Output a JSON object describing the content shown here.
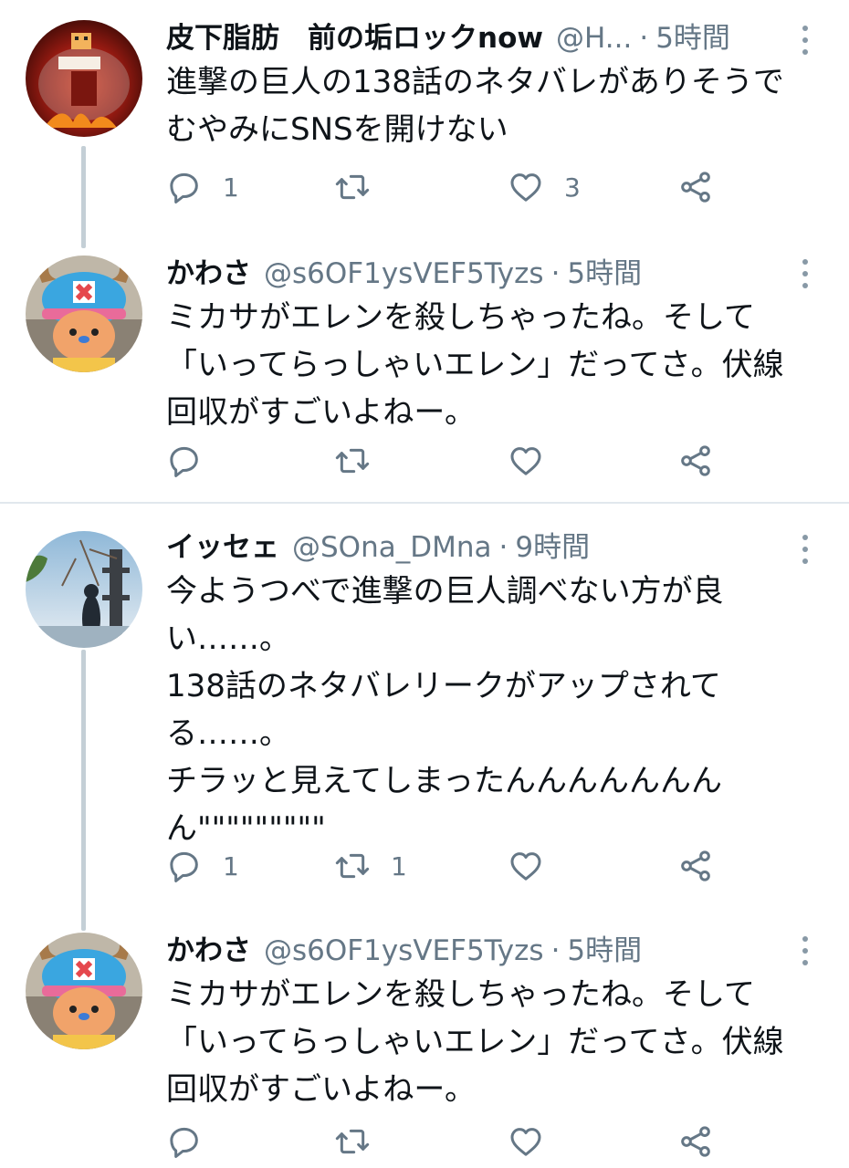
{
  "tweets": [
    {
      "name": "皮下脂肪　前の垢ロックnow",
      "handle": "@H...",
      "time": "5時間",
      "text": "進撃の巨人の138話のネタバレがありそうで\nむやみにSNSを開けない",
      "reply_count": "1",
      "retweet_count": "",
      "like_count": "3",
      "avatar_icon": "fire-character-avatar",
      "avatar_label": "皮下脂肪"
    },
    {
      "name": "かわさ",
      "handle": "@s6OF1ysVEF5Tyzs",
      "time": "5時間",
      "text": "ミカサがエレンを殺しちゃったね。そして\n「いってらっしゃいエレン」だってさ。伏線\n回収がすごいよねー。",
      "reply_count": "",
      "retweet_count": "",
      "like_count": "",
      "avatar_icon": "chopper-mascot-avatar"
    },
    {
      "name": "イッセェ",
      "handle": "@SOna_DMna",
      "time": "9時間",
      "text": "今ようつべで進撃の巨人調べない方が良\nい……。\n138話のネタバレリークがアップされて\nる……。\nチラッと見えてしまったんんんんんんん\nん\"\"\"\"\"\"\"\"\"",
      "reply_count": "1",
      "retweet_count": "1",
      "like_count": "",
      "avatar_icon": "tree-silhouette-avatar"
    },
    {
      "name": "かわさ",
      "handle": "@s6OF1ysVEF5Tyzs",
      "time": "5時間",
      "text": "ミカサがエレンを殺しちゃったね。そして\n「いってらっしゃいエレン」だってさ。伏線\n回収がすごいよねー。",
      "reply_count": "",
      "retweet_count": "",
      "like_count": "",
      "avatar_icon": "chopper-mascot-avatar"
    }
  ],
  "icons": {
    "reply": "reply-icon",
    "retweet": "retweet-icon",
    "like": "heart-icon",
    "share": "share-icon",
    "more": "more-options-icon"
  },
  "colors": {
    "text": "#0f1419",
    "secondary": "#657786",
    "thread_line": "#c4cfd6",
    "divider": "#e1e8ed"
  }
}
